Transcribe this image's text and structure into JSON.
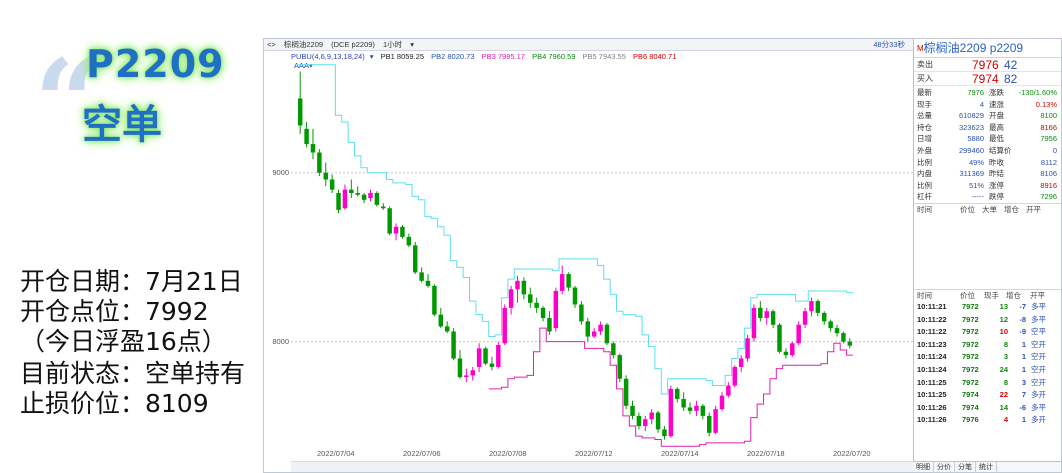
{
  "promo": {
    "code": "P2209",
    "side": "空单",
    "lines": [
      "开仓日期：7月21日",
      "开仓点位：7992",
      "（今日浮盈16点）",
      "目前状态：空单持有",
      "止损价位：8109"
    ]
  },
  "toolbar": {
    "title": "棕榈油2209",
    "code": "(DCE p2209)",
    "period": "1小时",
    "bars": "48分33秒"
  },
  "indicator": {
    "name": "PUBU(4,6,9,13,18,24)",
    "values": [
      {
        "label": "PB1 8059.25",
        "color": "#222222"
      },
      {
        "label": "PB2 8020.73",
        "color": "#2a50b0"
      },
      {
        "label": "PB3 7985.17",
        "color": "#e020b0"
      },
      {
        "label": "PB4 7960.59",
        "color": "#0a8a0a"
      },
      {
        "label": "PB5 7943.55",
        "color": "#808080"
      },
      {
        "label": "PB6 8040.71",
        "color": "#d10000"
      }
    ],
    "sub": "AAA"
  },
  "quote": {
    "title": "棕榈油2209  p2209",
    "sell_label": "卖出",
    "sell_price": "7976",
    "sell_vol": "42",
    "buy_label": "买入",
    "buy_price": "7974",
    "buy_vol": "82",
    "stats": [
      {
        "l1": "最新",
        "v1": "7976",
        "c1": "green",
        "l2": "涨跌",
        "v2": "-130/1.60%",
        "c2": "green"
      },
      {
        "l1": "现手",
        "v1": "4",
        "c1": "blue",
        "l2": "速涨",
        "v2": "0.13%",
        "c2": "red"
      },
      {
        "l1": "总量",
        "v1": "610829",
        "c1": "blue",
        "l2": "开盘",
        "v2": "8100",
        "c2": "green"
      },
      {
        "l1": "持仓",
        "v1": "323623",
        "c1": "blue",
        "l2": "最高",
        "v2": "8166",
        "c2": "red"
      },
      {
        "l1": "日增",
        "v1": "5880",
        "c1": "blue",
        "l2": "最低",
        "v2": "7956",
        "c2": "green"
      },
      {
        "l1": "外盘",
        "v1": "299460",
        "c1": "blue",
        "l2": "结算价",
        "v2": "0",
        "c2": "blue"
      },
      {
        "l1": "比例",
        "v1": "49%",
        "c1": "blue",
        "l2": "昨收",
        "v2": "8112",
        "c2": "blue"
      },
      {
        "l1": "内盘",
        "v1": "311369",
        "c1": "blue",
        "l2": "昨结",
        "v2": "8106",
        "c2": "blue"
      },
      {
        "l1": "比例",
        "v1": "51%",
        "c1": "blue",
        "l2": "涨停",
        "v2": "8916",
        "c2": "red"
      },
      {
        "l1": "杠杆",
        "v1": "-----",
        "c1": "blue",
        "l2": "跌停",
        "v2": "7296",
        "c2": "green"
      }
    ],
    "header1": [
      "时间",
      "价位",
      "大单",
      "增仓",
      "开平"
    ],
    "header2": [
      "时间",
      "价位",
      "现手",
      "增仓",
      "开平"
    ],
    "ticks": [
      {
        "time": "10:11:21",
        "price": "7972",
        "vol": "13",
        "vc": "green",
        "oi": "-7",
        "type": "多平"
      },
      {
        "time": "10:11:22",
        "price": "7972",
        "vol": "12",
        "vc": "green",
        "oi": "-8",
        "type": "多平"
      },
      {
        "time": "10:11:22",
        "price": "7972",
        "vol": "10",
        "vc": "red",
        "oi": "-9",
        "type": "空平"
      },
      {
        "time": "10:11:23",
        "price": "7972",
        "vol": "8",
        "vc": "green",
        "oi": "1",
        "type": "空开"
      },
      {
        "time": "10:11:24",
        "price": "7972",
        "vol": "3",
        "vc": "green",
        "oi": "1",
        "type": "空开"
      },
      {
        "time": "10:11:24",
        "price": "7972",
        "vol": "24",
        "vc": "green",
        "oi": "1",
        "type": "空开"
      },
      {
        "time": "10:11:25",
        "price": "7972",
        "vol": "8",
        "vc": "green",
        "oi": "3",
        "type": "空开"
      },
      {
        "time": "10:11:25",
        "price": "7974",
        "vol": "22",
        "vc": "red",
        "oi": "7",
        "type": "多开"
      },
      {
        "time": "10:11:26",
        "price": "7974",
        "vol": "14",
        "vc": "green",
        "oi": "-6",
        "type": "多平"
      },
      {
        "time": "10:11:26",
        "price": "7976",
        "vol": "4",
        "vc": "red",
        "oi": "1",
        "type": "多开"
      }
    ],
    "tabs": [
      "明细",
      "分价",
      "分笔",
      "统计"
    ]
  },
  "chart_data": {
    "type": "candlestick",
    "y_ticks": [
      9000,
      8000
    ],
    "ylim": [
      7370,
      9650
    ],
    "x_labels": [
      "2022/07/04",
      "2022/07/06",
      "2022/07/08",
      "2022/07/12",
      "2022/07/14",
      "2022/07/18",
      "2022/07/20"
    ],
    "colors": {
      "up": "#ff00cc",
      "down": "#009900",
      "upper_band": "#5ee0ee",
      "lower_band": "#e020b0",
      "flat": "#aaaaaa"
    },
    "candles": [
      [
        9440,
        9600,
        9230,
        9280
      ],
      [
        9260,
        9300,
        9150,
        9170
      ],
      [
        9170,
        9260,
        9080,
        9120
      ],
      [
        9120,
        9140,
        8980,
        9000
      ],
      [
        9000,
        9060,
        8920,
        8960
      ],
      [
        8960,
        8990,
        8880,
        8900
      ],
      [
        8880,
        8900,
        8760,
        8780
      ],
      [
        8790,
        8930,
        8780,
        8900
      ],
      [
        8900,
        8960,
        8850,
        8880
      ],
      [
        8880,
        8920,
        8860,
        8870
      ],
      [
        8870,
        8880,
        8820,
        8840
      ],
      [
        8850,
        8900,
        8830,
        8880
      ],
      [
        8880,
        8890,
        8800,
        8810
      ],
      [
        8800,
        8820,
        8780,
        8790
      ],
      [
        8790,
        8800,
        8630,
        8640
      ],
      [
        8640,
        8700,
        8600,
        8680
      ],
      [
        8680,
        8690,
        8610,
        8620
      ],
      [
        8620,
        8640,
        8560,
        8570
      ],
      [
        8570,
        8590,
        8400,
        8410
      ],
      [
        8410,
        8440,
        8350,
        8360
      ],
      [
        8360,
        8400,
        8320,
        8330
      ],
      [
        8330,
        8340,
        8150,
        8160
      ],
      [
        8160,
        8200,
        8080,
        8090
      ],
      [
        8090,
        8120,
        8050,
        8060
      ],
      [
        8060,
        8080,
        7890,
        7900
      ],
      [
        7900,
        7950,
        7780,
        7790
      ],
      [
        7790,
        7840,
        7760,
        7800
      ],
      [
        7800,
        7850,
        7770,
        7830
      ],
      [
        7850,
        7990,
        7820,
        7960
      ],
      [
        7960,
        7970,
        7860,
        7870
      ],
      [
        7870,
        7910,
        7830,
        7850
      ],
      [
        7850,
        8000,
        7840,
        7980
      ],
      [
        7990,
        8220,
        7980,
        8200
      ],
      [
        8200,
        8330,
        8160,
        8310
      ],
      [
        8310,
        8390,
        8230,
        8360
      ],
      [
        8360,
        8380,
        8250,
        8280
      ],
      [
        8280,
        8320,
        8200,
        8230
      ],
      [
        8230,
        8260,
        8170,
        8200
      ],
      [
        8200,
        8210,
        8120,
        8140
      ],
      [
        8140,
        8180,
        8040,
        8060
      ],
      [
        8080,
        8320,
        8060,
        8300
      ],
      [
        8300,
        8450,
        8280,
        8400
      ],
      [
        8400,
        8410,
        8300,
        8320
      ],
      [
        8320,
        8330,
        8200,
        8220
      ],
      [
        8220,
        8240,
        8100,
        8120
      ],
      [
        8120,
        8140,
        8000,
        8030
      ],
      [
        8030,
        8080,
        8020,
        8060
      ],
      [
        8060,
        8120,
        8040,
        8100
      ],
      [
        8100,
        8110,
        7980,
        7990
      ],
      [
        7990,
        8000,
        7900,
        7920
      ],
      [
        7920,
        7930,
        7760,
        7780
      ],
      [
        7780,
        7800,
        7600,
        7620
      ],
      [
        7620,
        7650,
        7540,
        7560
      ],
      [
        7560,
        7580,
        7480,
        7500
      ],
      [
        7500,
        7560,
        7470,
        7540
      ],
      [
        7540,
        7600,
        7510,
        7580
      ],
      [
        7580,
        7590,
        7460,
        7480
      ],
      [
        7480,
        7500,
        7420,
        7440
      ],
      [
        7440,
        7740,
        7430,
        7720
      ],
      [
        7720,
        7730,
        7640,
        7660
      ],
      [
        7660,
        7700,
        7590,
        7610
      ],
      [
        7610,
        7640,
        7570,
        7590
      ],
      [
        7590,
        7650,
        7560,
        7620
      ],
      [
        7620,
        7630,
        7540,
        7560
      ],
      [
        7560,
        7580,
        7440,
        7460
      ],
      [
        7460,
        7620,
        7450,
        7600
      ],
      [
        7600,
        7700,
        7590,
        7680
      ],
      [
        7680,
        7760,
        7670,
        7740
      ],
      [
        7740,
        7860,
        7730,
        7850
      ],
      [
        7850,
        7920,
        7820,
        7900
      ],
      [
        7900,
        8040,
        7880,
        8020
      ],
      [
        8020,
        8220,
        8000,
        8200
      ],
      [
        8200,
        8240,
        8120,
        8140
      ],
      [
        8140,
        8200,
        8100,
        8180
      ],
      [
        8180,
        8190,
        8080,
        8100
      ],
      [
        8100,
        8110,
        7930,
        7940
      ],
      [
        7940,
        7960,
        7900,
        7920
      ],
      [
        7920,
        8000,
        7910,
        7990
      ],
      [
        7990,
        8120,
        7980,
        8100
      ],
      [
        8100,
        8200,
        8080,
        8180
      ],
      [
        8180,
        8260,
        8150,
        8240
      ],
      [
        8240,
        8250,
        8150,
        8170
      ],
      [
        8170,
        8180,
        8100,
        8120
      ],
      [
        8120,
        8130,
        8060,
        8080
      ],
      [
        8080,
        8100,
        8030,
        8050
      ],
      [
        8050,
        8060,
        7990,
        8000
      ],
      [
        8000,
        8020,
        7960,
        7976
      ]
    ]
  }
}
